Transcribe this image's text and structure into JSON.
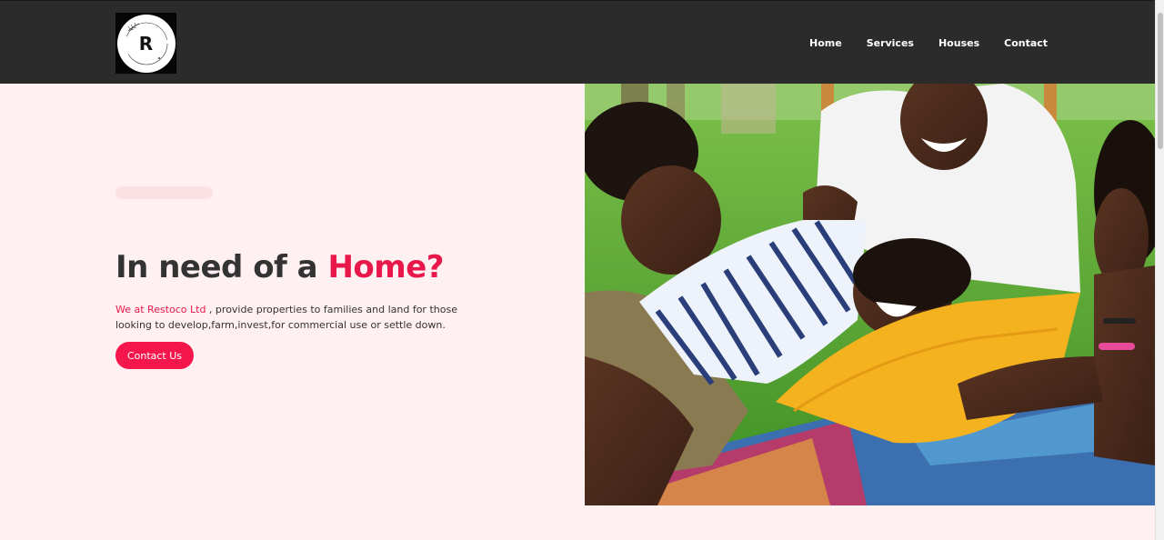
{
  "brand": {
    "logo_letter": "R"
  },
  "nav": {
    "items": [
      {
        "label": "Home"
      },
      {
        "label": "Services"
      },
      {
        "label": "Houses"
      },
      {
        "label": "Contact"
      }
    ]
  },
  "hero": {
    "title_prefix": "In need of a ",
    "title_accent": "Home?",
    "desc_company": "We at Restoco Ltd",
    "desc_rest": " , provide properties to families and land for those looking to develop,farm,invest,for commercial use or settle down.",
    "cta_label": "Contact Us",
    "image_icon": "family-photo"
  },
  "colors": {
    "navbar": "#2b2b2b",
    "accent": "#e8194a",
    "hero_bg": "#fff0f1",
    "button": "#f5174c"
  }
}
